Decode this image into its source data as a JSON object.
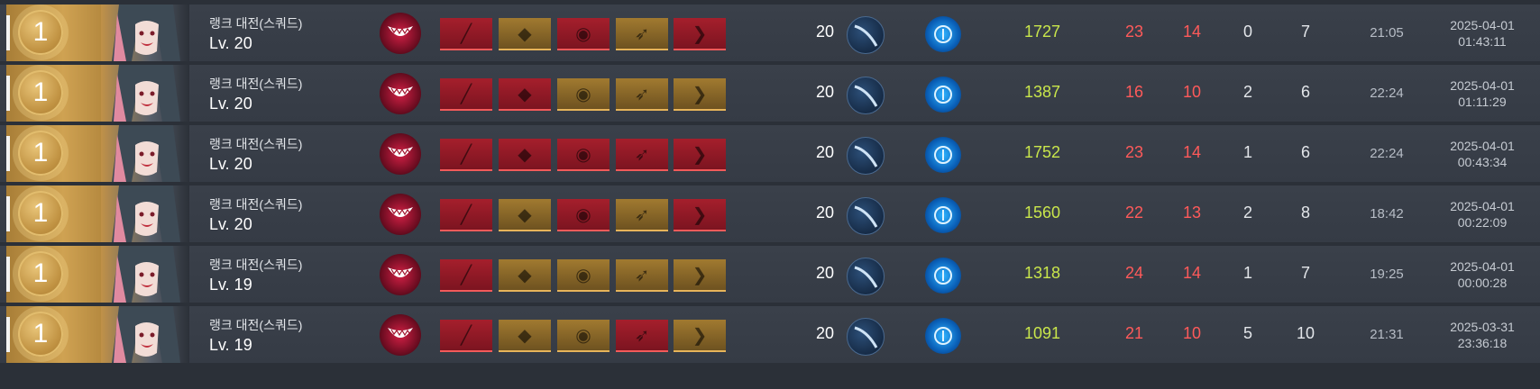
{
  "matches": [
    {
      "rank": "1",
      "mode": "랭크 대전(스쿼드)",
      "level": "Lv. 20",
      "items": [
        "red",
        "gold",
        "red",
        "gold",
        "red"
      ],
      "character_level": "20",
      "score": "1727",
      "kills": "23",
      "assists": "14",
      "deaths": "0",
      "stat4": "7",
      "duration": "21:05",
      "date": "2025-04-01",
      "time": "01:43:11"
    },
    {
      "rank": "1",
      "mode": "랭크 대전(스쿼드)",
      "level": "Lv. 20",
      "items": [
        "red",
        "red",
        "gold",
        "gold",
        "gold"
      ],
      "character_level": "20",
      "score": "1387",
      "kills": "16",
      "assists": "10",
      "deaths": "2",
      "stat4": "6",
      "duration": "22:24",
      "date": "2025-04-01",
      "time": "01:11:29"
    },
    {
      "rank": "1",
      "mode": "랭크 대전(스쿼드)",
      "level": "Lv. 20",
      "items": [
        "red",
        "red",
        "red",
        "red",
        "red"
      ],
      "character_level": "20",
      "score": "1752",
      "kills": "23",
      "assists": "14",
      "deaths": "1",
      "stat4": "6",
      "duration": "22:24",
      "date": "2025-04-01",
      "time": "00:43:34"
    },
    {
      "rank": "1",
      "mode": "랭크 대전(스쿼드)",
      "level": "Lv. 20",
      "items": [
        "red",
        "gold",
        "red",
        "gold",
        "red"
      ],
      "character_level": "20",
      "score": "1560",
      "kills": "22",
      "assists": "13",
      "deaths": "2",
      "stat4": "8",
      "duration": "18:42",
      "date": "2025-04-01",
      "time": "00:22:09"
    },
    {
      "rank": "1",
      "mode": "랭크 대전(스쿼드)",
      "level": "Lv. 19",
      "items": [
        "red",
        "gold",
        "gold",
        "gold",
        "gold"
      ],
      "character_level": "20",
      "score": "1318",
      "kills": "24",
      "assists": "14",
      "deaths": "1",
      "stat4": "7",
      "duration": "19:25",
      "date": "2025-04-01",
      "time": "00:00:28"
    },
    {
      "rank": "1",
      "mode": "랭크 대전(스쿼드)",
      "level": "Lv. 19",
      "items": [
        "red",
        "gold",
        "gold",
        "red",
        "gold"
      ],
      "character_level": "20",
      "score": "1091",
      "kills": "21",
      "assists": "10",
      "deaths": "5",
      "stat4": "10",
      "duration": "21:31",
      "date": "2025-03-31",
      "time": "23:36:18"
    }
  ],
  "icons": {
    "character": "grinning-mouth-icon",
    "weapon_skill": "blade-slash-icon",
    "tactical_skill": "blue-core-icon"
  },
  "colors": {
    "score": "#c9e64b",
    "kills_assists": "#ff5a5a",
    "rank_gold": "#cfa252"
  }
}
